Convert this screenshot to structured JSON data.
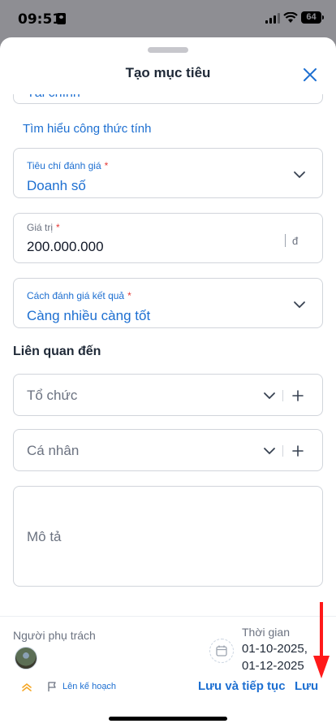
{
  "status_bar": {
    "time": "09:51",
    "battery": "64"
  },
  "sheet": {
    "title": "Tạo mục tiêu"
  },
  "category_field": {
    "value": "Tài chính"
  },
  "formula_link": "Tìm hiểu công thức tính",
  "criteria_field": {
    "label": "Tiêu chí đánh giá",
    "required": "*",
    "value": "Doanh số"
  },
  "value_field": {
    "label": "Giá trị",
    "required": "*",
    "value": "200.000.000",
    "unit": "đ"
  },
  "evaluation_field": {
    "label": "Cách đánh giá kết quả",
    "required": "*",
    "value": "Càng nhiều càng tốt"
  },
  "related_section": {
    "title": "Liên quan đến"
  },
  "organization_field": {
    "placeholder": "Tổ chức"
  },
  "person_field": {
    "placeholder": "Cá nhân"
  },
  "description_field": {
    "placeholder": "Mô tả"
  },
  "footer": {
    "owner_label": "Người phụ trách",
    "time_label": "Thời gian",
    "start_date": "01-10-2025,",
    "end_date": "01-12-2025",
    "plan_label": "Lên kế hoạch",
    "save_continue_label": "Lưu và tiếp tục",
    "save_label": "Lưu"
  },
  "colors": {
    "accent": "#1d6fd1",
    "required": "#e53935",
    "priority": "#f5a623",
    "annotation_arrow": "#ff1a1a"
  },
  "icons": [
    "close-icon",
    "chevron-down-icon",
    "plus-icon",
    "calendar-icon",
    "flag-icon",
    "priority-chevrons-icon",
    "avatar"
  ]
}
